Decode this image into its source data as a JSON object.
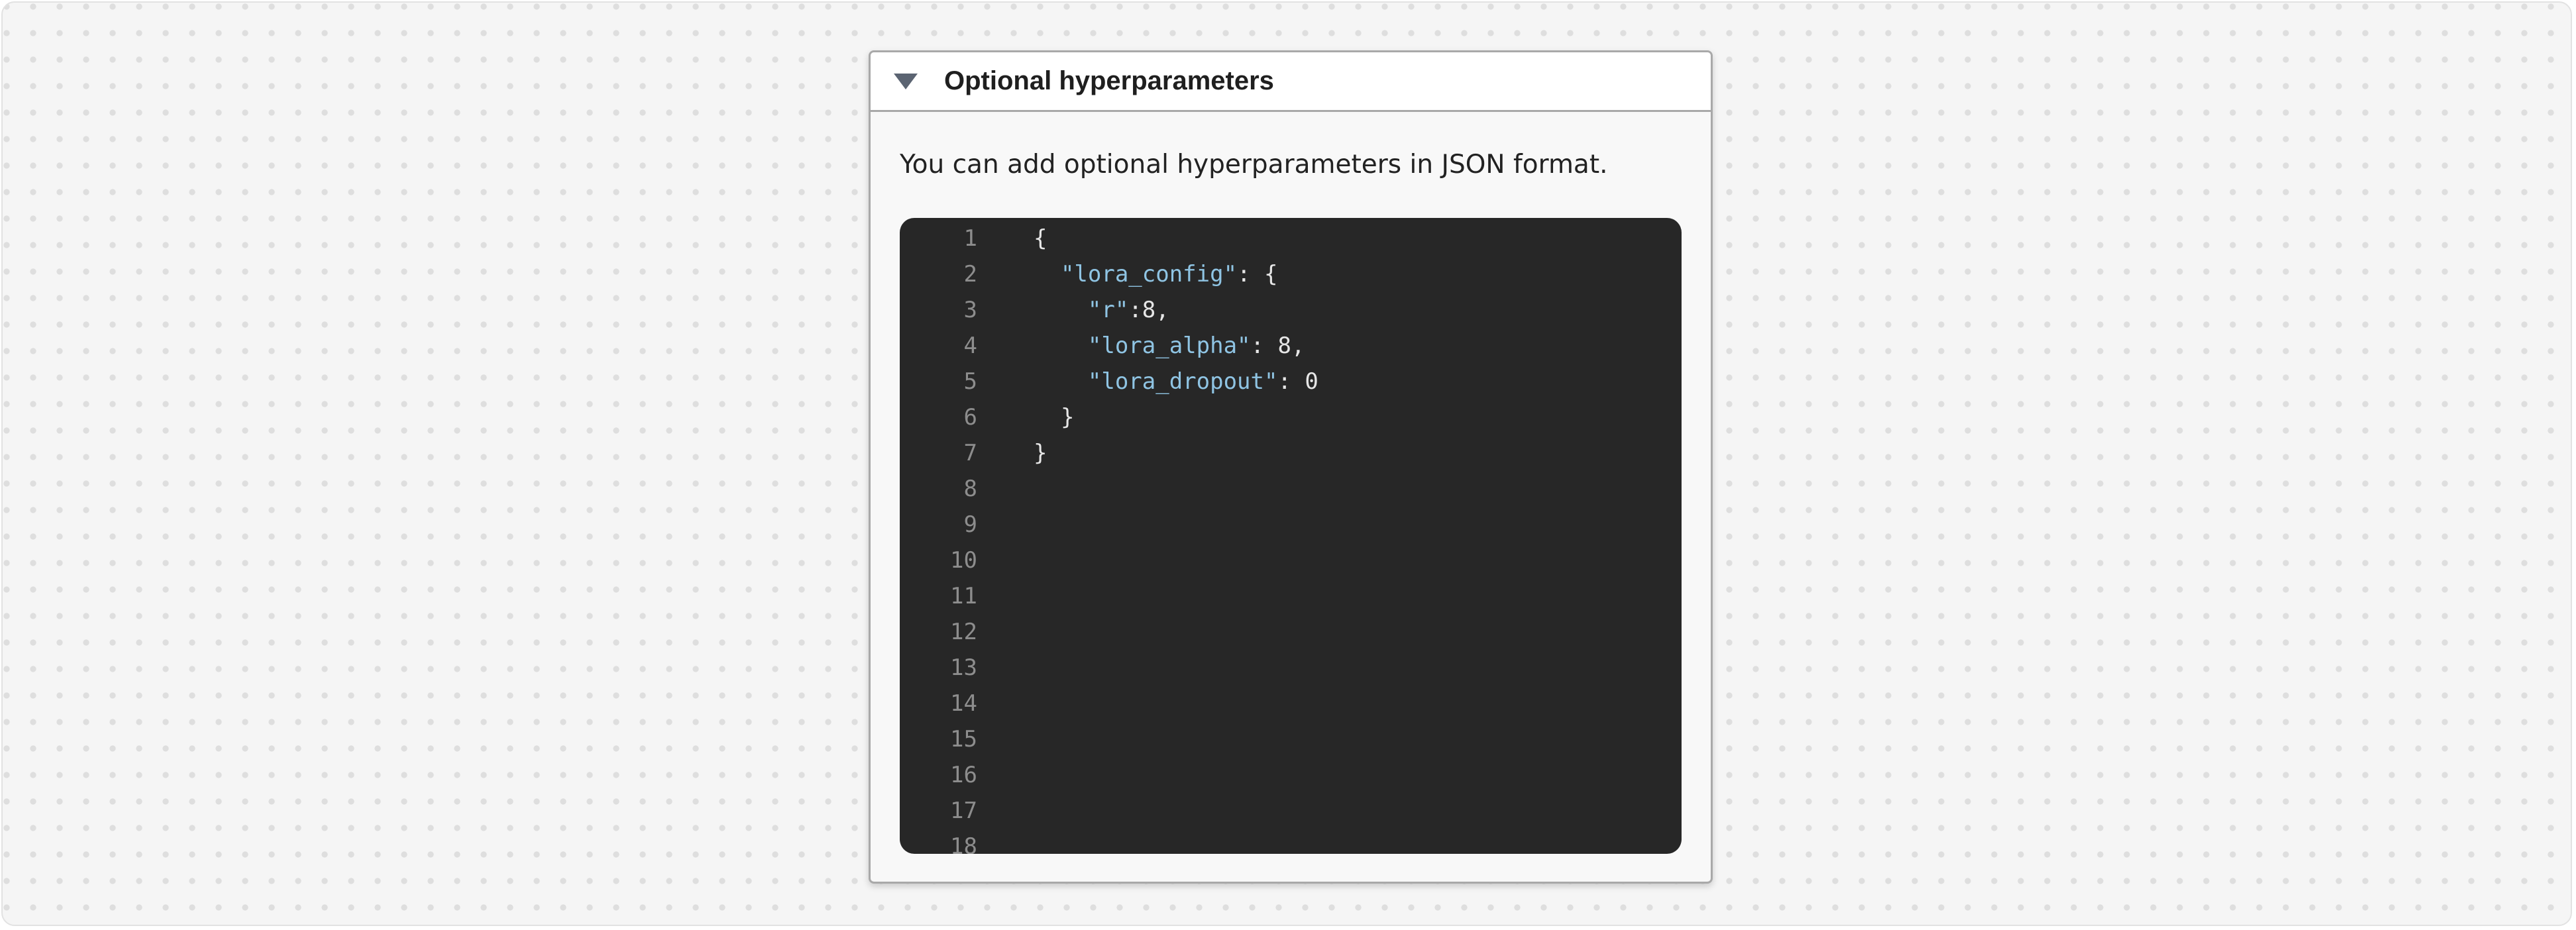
{
  "panel": {
    "title": "Optional hyperparameters",
    "expanded": true,
    "description": "You can add optional hyperparameters in JSON format."
  },
  "icons": {
    "toggle": "caret-down-icon"
  },
  "editor": {
    "language": "json",
    "line_numbers": [
      "1",
      "2",
      "3",
      "4",
      "5",
      "6",
      "7",
      "8",
      "9",
      "10",
      "11",
      "12",
      "13",
      "14",
      "15",
      "16",
      "17",
      "18"
    ],
    "lines": [
      [
        {
          "t": "punc",
          "v": "{"
        }
      ],
      [
        {
          "t": "punc",
          "v": "  "
        },
        {
          "t": "key",
          "v": "\"lora_config\""
        },
        {
          "t": "punc",
          "v": ": {"
        }
      ],
      [
        {
          "t": "punc",
          "v": "    "
        },
        {
          "t": "key",
          "v": "\"r\""
        },
        {
          "t": "punc",
          "v": ":8,"
        }
      ],
      [
        {
          "t": "punc",
          "v": "    "
        },
        {
          "t": "key",
          "v": "\"lora_alpha\""
        },
        {
          "t": "punc",
          "v": ": 8,"
        }
      ],
      [
        {
          "t": "punc",
          "v": "    "
        },
        {
          "t": "key",
          "v": "\"lora_dropout\""
        },
        {
          "t": "punc",
          "v": ": 0"
        }
      ],
      [
        {
          "t": "punc",
          "v": "  }"
        }
      ],
      [
        {
          "t": "punc",
          "v": "}"
        }
      ],
      [],
      [],
      [],
      [],
      [],
      [],
      [],
      [],
      [],
      [],
      []
    ]
  },
  "colors": {
    "editor_background": "#272727",
    "json_key": "#8fc4e3",
    "line_number": "#8d8d8d",
    "code_text": "#e6e6e6"
  }
}
